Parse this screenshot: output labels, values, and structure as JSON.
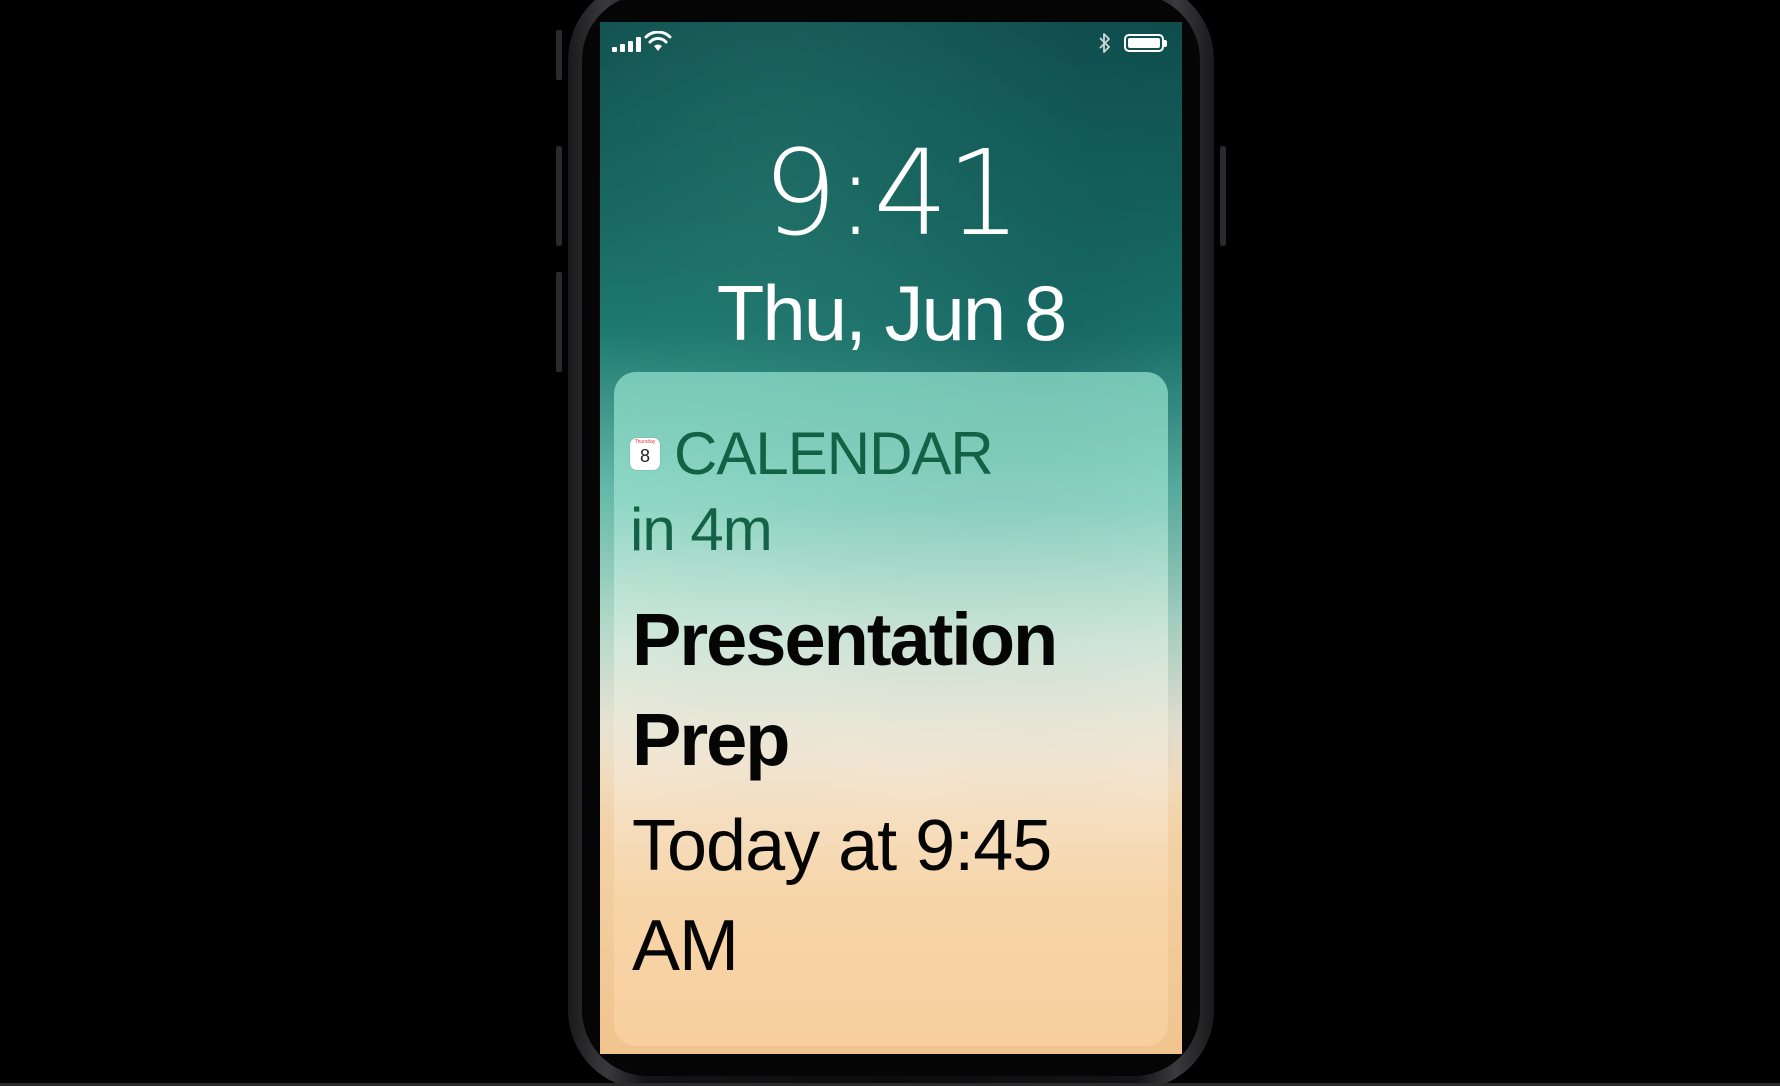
{
  "status_bar": {
    "signal_bars": 4,
    "signal_icon": "cellular-signal-icon",
    "wifi_icon": "wifi-icon",
    "bluetooth_icon": "bluetooth-icon",
    "battery_icon": "battery-icon",
    "battery_level": 1.0
  },
  "lock_screen": {
    "time": "9:41",
    "date": "Thu, Jun 8"
  },
  "notification": {
    "app_icon": "calendar-app-icon",
    "app_icon_day_of_week": "Thursday",
    "app_icon_day": "8",
    "app_name": "CALENDAR",
    "time_ago": "in 4m",
    "title": "Presentation Prep",
    "body": "Today at 9:45 AM",
    "colors": {
      "header_text": "#136246",
      "title_text": "#050505"
    }
  }
}
